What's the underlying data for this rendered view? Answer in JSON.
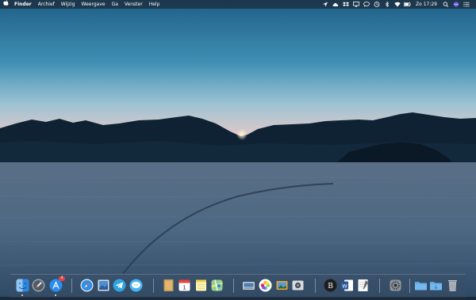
{
  "menubar": {
    "app_name": "Finder",
    "menus": [
      "Archief",
      "Wijzig",
      "Weergave",
      "Ga",
      "Venster",
      "Help"
    ],
    "clock": "Zo 17:29"
  },
  "status_icons": [
    "location-icon",
    "cloud-icon",
    "dropbox-icon",
    "airplay-icon",
    "messages-icon",
    "time-machine-icon",
    "bluetooth-icon",
    "wifi-icon",
    "battery-icon",
    "spotlight-icon",
    "siri-icon",
    "notification-center-icon"
  ],
  "dock": {
    "apps": [
      {
        "name": "finder-icon",
        "running": true
      },
      {
        "name": "launchpad-icon",
        "running": false
      },
      {
        "name": "app-store-icon",
        "running": true,
        "badge": "4"
      },
      {
        "name": "safari-icon",
        "running": false
      },
      {
        "name": "preview-icon",
        "running": false
      },
      {
        "name": "telegram-icon",
        "running": false
      },
      {
        "name": "messages-icon",
        "running": false
      },
      {
        "name": "notefile-icon",
        "running": false
      },
      {
        "name": "calendar-icon",
        "running": false
      },
      {
        "name": "notes-icon",
        "running": false
      },
      {
        "name": "maps-icon",
        "running": false
      },
      {
        "name": "image-capture-icon",
        "running": false
      },
      {
        "name": "photos-icon",
        "running": false
      },
      {
        "name": "photo-slideshow-icon",
        "running": false
      },
      {
        "name": "screenshot-utility-icon",
        "running": false
      },
      {
        "name": "bbedit-icon",
        "running": false
      },
      {
        "name": "word-icon",
        "running": false
      },
      {
        "name": "textedit-icon",
        "running": false
      },
      {
        "name": "system-preferences-icon",
        "running": false
      },
      {
        "name": "applications-folder-icon",
        "running": false
      },
      {
        "name": "downloads-folder-icon",
        "running": false
      },
      {
        "name": "trash-icon",
        "running": false
      }
    ]
  }
}
